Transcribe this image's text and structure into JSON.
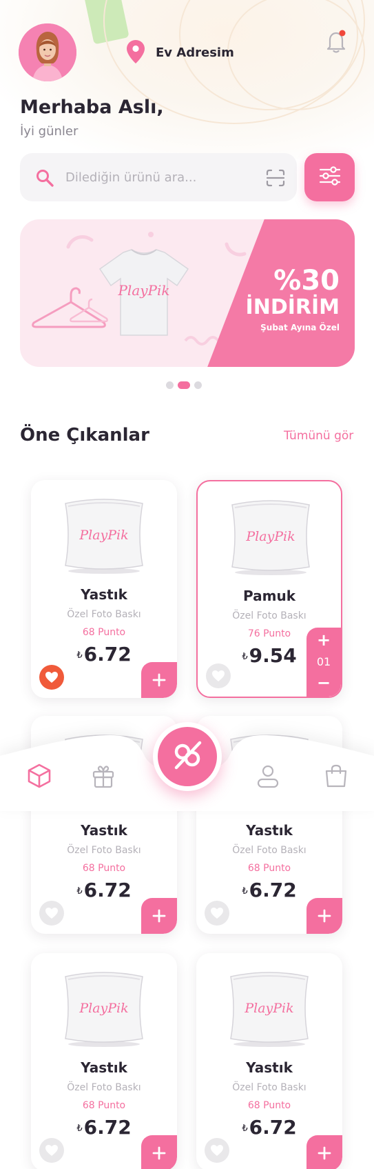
{
  "header": {
    "address_label": "Ev Adresim",
    "greeting": "Merhaba Aslı,",
    "subgreeting": "İyi günler"
  },
  "search": {
    "placeholder": "Dilediğin ürünü ara..."
  },
  "banner": {
    "logo_text": "PlayPik",
    "discount": "%30",
    "headline": "İNDİRİM",
    "note": "Şubat Ayına Özel"
  },
  "carousel": {
    "total": 3,
    "active": 2
  },
  "section": {
    "title": "Öne Çıkanlar",
    "see_all": "Tümünü gör"
  },
  "products": [
    {
      "name": "Yastık",
      "desc": "Özel Foto Baskı",
      "points": "68 Punto",
      "currency": "₺",
      "price": "6.72",
      "favorite": true,
      "selected": false
    },
    {
      "name": "Pamuk",
      "desc": "Özel Foto Baskı",
      "points": "76 Punto",
      "currency": "₺",
      "price": "9.54",
      "favorite": false,
      "selected": true,
      "quantity": "01"
    },
    {
      "name": "Yastık",
      "desc": "Özel Foto Baskı",
      "points": "68 Punto",
      "currency": "₺",
      "price": "6.72",
      "favorite": false,
      "selected": false
    },
    {
      "name": "Yastık",
      "desc": "Özel Foto Baskı",
      "points": "68 Punto",
      "currency": "₺",
      "price": "6.72",
      "favorite": false,
      "selected": false
    },
    {
      "name": "Yastık",
      "desc": "Özel Foto Baskı",
      "points": "68 Punto",
      "currency": "₺",
      "price": "6.72",
      "favorite": false,
      "selected": false
    },
    {
      "name": "Yastık",
      "desc": "Özel Foto Baskı",
      "points": "68 Punto",
      "currency": "₺",
      "price": "6.72",
      "favorite": false,
      "selected": false
    }
  ],
  "nav": {
    "items": [
      "cube-icon",
      "gift-icon",
      "playpik-logo-icon",
      "user-icon",
      "shopping-bag-icon"
    ],
    "active": "cube-icon"
  },
  "colors": {
    "accent": "#f46f9f",
    "text": "#2b2633",
    "muted": "#b4b1b8",
    "favorite": "#f05a3a"
  }
}
